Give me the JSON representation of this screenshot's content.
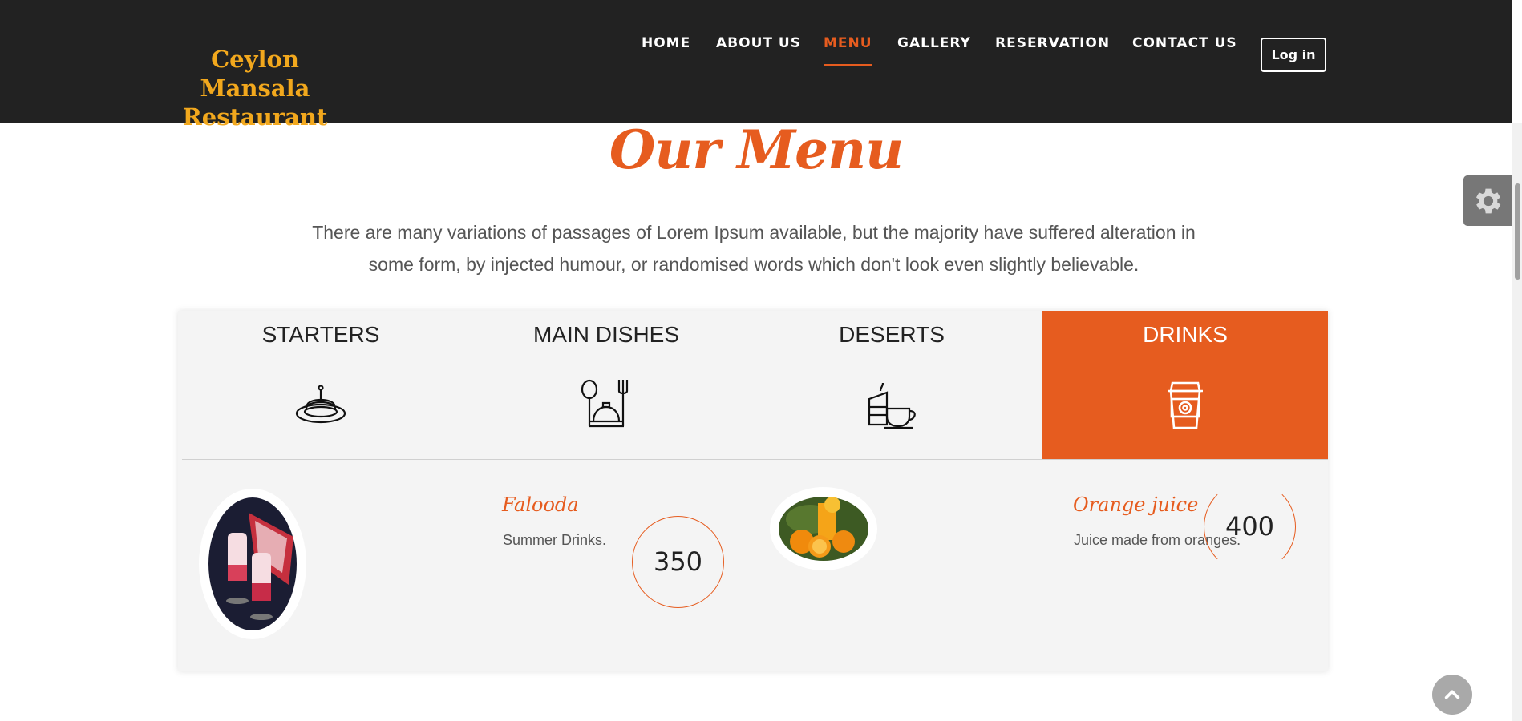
{
  "header": {
    "brand": "Ceylon Mansala Restaurant",
    "nav": [
      "HOME",
      "ABOUT US",
      "MENU",
      "GALLERY",
      "RESERVATION",
      "CONTACT US"
    ],
    "active_nav": "MENU",
    "login_label": "Log in"
  },
  "main": {
    "title": "Our Menu",
    "intro": "There are many variations of passages of Lorem Ipsum available, but the majority have suffered alteration in some form, by injected humour, or randomised words which don't look even slightly believable."
  },
  "tabs": [
    {
      "label": "STARTERS",
      "icon": "pancake-plate-icon"
    },
    {
      "label": "MAIN DISHES",
      "icon": "cloche-cutlery-icon"
    },
    {
      "label": "DESERTS",
      "icon": "cake-coffee-icon"
    },
    {
      "label": "DRINKS",
      "icon": "coffee-cup-icon"
    }
  ],
  "active_tab": "DRINKS",
  "items": [
    {
      "name": "Falooda",
      "description": "Summer Drinks.",
      "price": "350",
      "image": "falooda-image"
    },
    {
      "name": "Orange juice",
      "description": "Juice made from oranges.",
      "price": "400",
      "image": "orange-juice-image"
    }
  ],
  "colors": {
    "accent": "#e65c1f",
    "brand": "#f2a81d",
    "header_bg": "#222222",
    "panel_bg": "#f4f4f4"
  }
}
